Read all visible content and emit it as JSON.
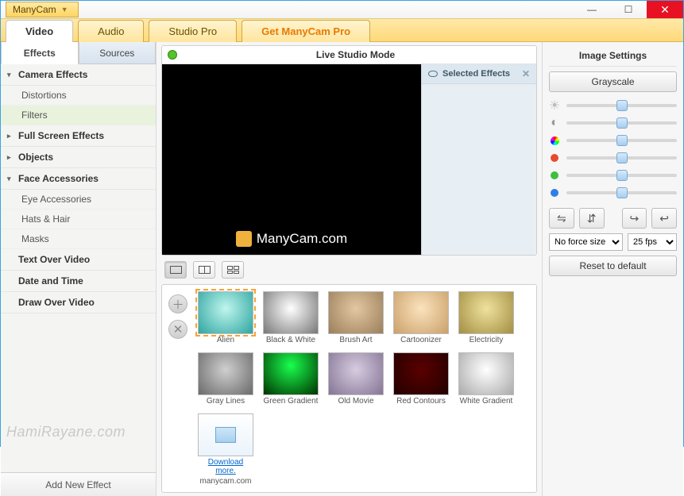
{
  "app": {
    "menu_label": "ManyCam"
  },
  "tabs": {
    "video": "Video",
    "audio": "Audio",
    "studio": "Studio Pro",
    "promo": "Get ManyCam Pro"
  },
  "sidebar": {
    "tab_effects": "Effects",
    "tab_sources": "Sources",
    "cat_camera": "Camera Effects",
    "sub_distortions": "Distortions",
    "sub_filters": "Filters",
    "cat_fullscreen": "Full Screen Effects",
    "cat_objects": "Objects",
    "cat_face": "Face Accessories",
    "sub_eye": "Eye Accessories",
    "sub_hats": "Hats & Hair",
    "sub_masks": "Masks",
    "cat_text": "Text Over Video",
    "cat_date": "Date and Time",
    "cat_draw": "Draw Over Video",
    "add_effect": "Add New Effect"
  },
  "preview": {
    "title": "Live Studio Mode",
    "watermark": "ManyCam.com",
    "selected_title": "Selected Effects"
  },
  "gallery": {
    "items": [
      {
        "label": "Alien"
      },
      {
        "label": "Black & White"
      },
      {
        "label": "Brush Art"
      },
      {
        "label": "Cartoonizer"
      },
      {
        "label": "Electricity"
      },
      {
        "label": "Gray Lines"
      },
      {
        "label": "Green Gradient"
      },
      {
        "label": "Old Movie"
      },
      {
        "label": "Red Contours"
      },
      {
        "label": "White Gradient"
      },
      {
        "label": "manycam.com"
      }
    ],
    "download_link": "Download more."
  },
  "settings": {
    "title": "Image Settings",
    "grayscale": "Grayscale",
    "reset": "Reset to default",
    "size_options": [
      "No force size"
    ],
    "size_selected": "No force size",
    "fps_options": [
      "25 fps"
    ],
    "fps_selected": "25 fps",
    "sliders": {
      "brightness": 50,
      "contrast": 50,
      "color": 50,
      "red": 50,
      "green": 50,
      "blue": 50
    }
  },
  "watermark": "HamiRayane.com"
}
